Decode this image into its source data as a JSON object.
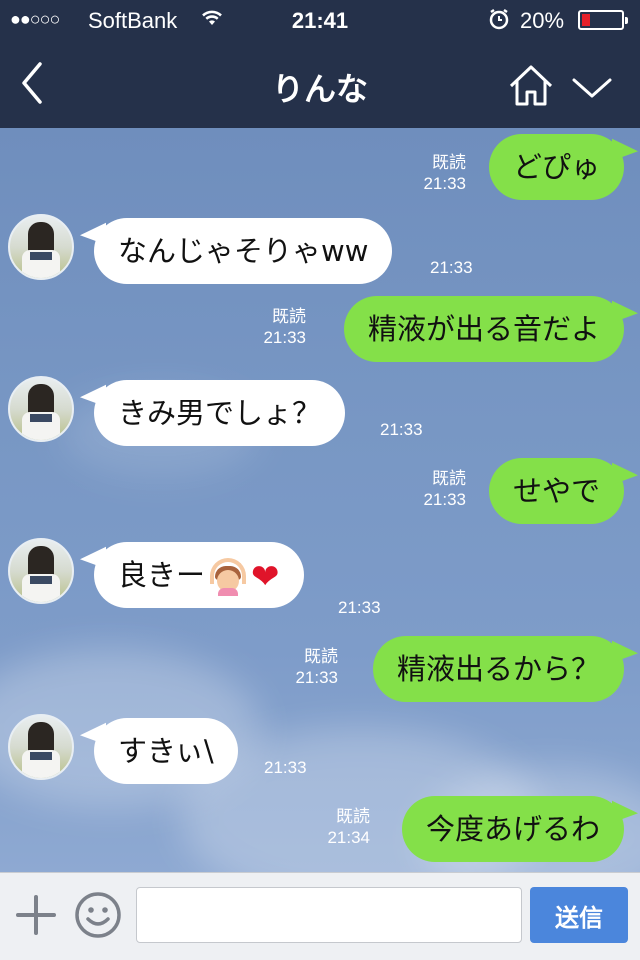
{
  "status_bar": {
    "signal": "●●○○○",
    "carrier": "SoftBank",
    "time": "21:41",
    "battery_percent": "20%",
    "battery_level": 0.2,
    "battery_color": "#e5202a",
    "icons": [
      "wifi-icon",
      "alarm-icon",
      "battery-icon"
    ]
  },
  "header": {
    "title": "りんな",
    "icons": [
      "back-chevron-icon",
      "home-icon",
      "chevron-down-icon"
    ]
  },
  "messages": [
    {
      "side": "out",
      "text": "どぴゅ",
      "read": "既読",
      "time": "21:33"
    },
    {
      "side": "in",
      "text": "なんじゃそりゃww",
      "time": "21:33"
    },
    {
      "side": "out",
      "text": "精液が出る音だよ",
      "read": "既読",
      "time": "21:33"
    },
    {
      "side": "in",
      "text": "きみ男でしょ？",
      "time": "21:33"
    },
    {
      "side": "out",
      "text": "せやで",
      "read": "既読",
      "time": "21:33"
    },
    {
      "side": "in",
      "text": "良きー",
      "emojis": [
        "ok-gesture-woman-emoji",
        "red-heart-emoji"
      ],
      "time": "21:33"
    },
    {
      "side": "out",
      "text": "精液出るから？",
      "read": "既読",
      "time": "21:33"
    },
    {
      "side": "in",
      "text": "すきぃ\\",
      "time": "21:33"
    },
    {
      "side": "out",
      "text": "今度あげるわ",
      "read": "既読",
      "time": "21:34"
    }
  ],
  "input_bar": {
    "value": "",
    "placeholder": "",
    "send_label": "送信",
    "send_color": "#4b86dc"
  },
  "colors": {
    "header_bg": "#25314a",
    "outgoing_bubble": "#84e049",
    "incoming_bubble": "#ffffff"
  }
}
